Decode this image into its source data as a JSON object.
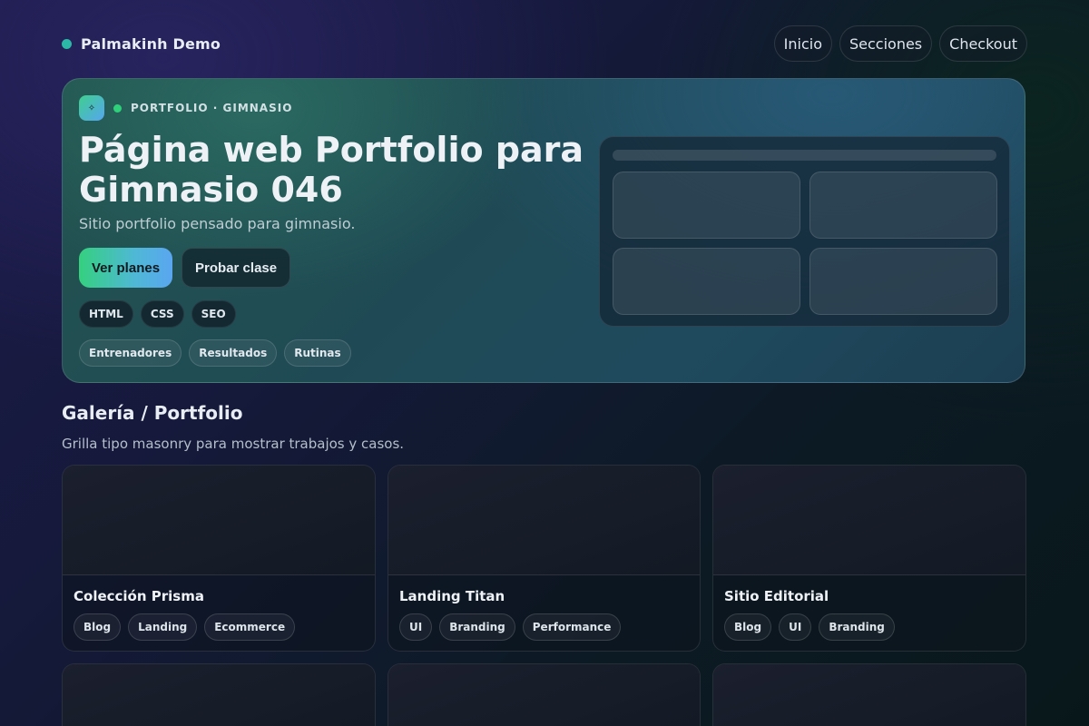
{
  "brand": {
    "name": "Palmakinh Demo",
    "dot_color": "#2bb8a6"
  },
  "nav": {
    "links": [
      "Inicio",
      "Secciones",
      "Checkout"
    ]
  },
  "hero": {
    "logo_glyph": "✧",
    "eyebrow": "PORTFOLIO · GIMNASIO",
    "title": "Página web Portfolio para Gimnasio 046",
    "subtitle": "Sitio portfolio pensado para gimnasio.",
    "primary_cta": "Ver planes",
    "secondary_cta": "Probar clase",
    "tech_tags": [
      "HTML",
      "CSS",
      "SEO"
    ],
    "topic_tags": [
      "Entrenadores",
      "Resultados",
      "Rutinas"
    ],
    "accent_gradient": [
      "#35d07f",
      "#5aa6f0"
    ]
  },
  "gallery": {
    "title": "Galería / Portfolio",
    "subtitle": "Grilla tipo masonry para mostrar trabajos y casos.",
    "cards": [
      {
        "title": "Colección Prisma",
        "tags": [
          "Blog",
          "Landing",
          "Ecommerce"
        ]
      },
      {
        "title": "Landing Titan",
        "tags": [
          "UI",
          "Branding",
          "Performance"
        ]
      },
      {
        "title": "Sitio Editorial",
        "tags": [
          "Blog",
          "UI",
          "Branding"
        ]
      }
    ]
  }
}
